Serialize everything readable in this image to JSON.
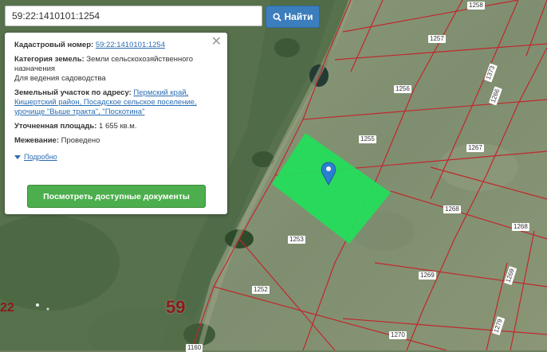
{
  "search": {
    "value": "59:22:1410101:1254",
    "button_label": "Найти"
  },
  "info_panel": {
    "cadastral_label": "Кадастровый номер:",
    "cadastral_value": "59:22:1410101:1254",
    "category_label": "Категория земель:",
    "category_value": "Земли сельскохозяйственного назначения",
    "use_value": "Для ведения садоводства",
    "address_label": "Земельный участок по адресу:",
    "address_value": "Пермский край, Кишертский район, Посадское сельское поселение, урочище \"Выше тракта\", \"Поскотина\"",
    "area_label": "Уточненная площадь:",
    "area_value": "1 655 кв.м.",
    "survey_label": "Межевание:",
    "survey_value": "Проведено",
    "details_link": "Подробно",
    "docs_button": "Посмотреть доступные документы"
  },
  "map": {
    "region_number": "59",
    "region_number_left": "22",
    "plot_labels": [
      "1258",
      "1257",
      "1256",
      "1373",
      "1266",
      "1255",
      "1267",
      "1268",
      "1268",
      "1253",
      "1269",
      "1269",
      "1252",
      "1270",
      "1279",
      "1160"
    ],
    "highlight_color": "#22e05a",
    "boundary_color": "#c0282d",
    "marker_color": "#2a7fd0"
  }
}
